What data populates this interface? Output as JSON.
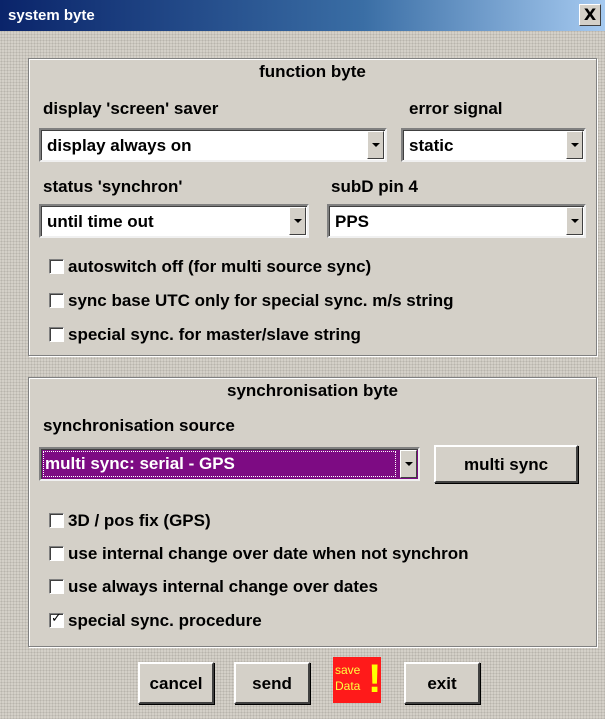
{
  "window": {
    "title": "system byte",
    "close_glyph": "X"
  },
  "function_byte": {
    "title": "function byte",
    "screen_saver": {
      "label": "display 'screen' saver",
      "value": "display always on"
    },
    "error_signal": {
      "label": "error signal",
      "value": "static"
    },
    "status_synchron": {
      "label": "status 'synchron'",
      "value": "until time out"
    },
    "subd_pin4": {
      "label": "subD pin 4",
      "value": "PPS"
    },
    "checkboxes": [
      {
        "label": "autoswitch off (for multi source sync)",
        "checked": false
      },
      {
        "label": "sync base UTC only for special sync. m/s string",
        "checked": false
      },
      {
        "label": "special sync. for master/slave string",
        "checked": false
      }
    ]
  },
  "sync_byte": {
    "title": "synchronisation byte",
    "source": {
      "label": "synchronisation source",
      "value": "multi sync:  serial - GPS"
    },
    "multi_sync_button": "multi sync",
    "checkboxes": [
      {
        "label": "3D / pos fix (GPS)",
        "checked": false
      },
      {
        "label": "use internal change over date when not synchron",
        "checked": false
      },
      {
        "label": "use always internal change over dates",
        "checked": false
      },
      {
        "label": "special sync. procedure",
        "checked": true
      }
    ]
  },
  "buttons": {
    "cancel": "cancel",
    "send": "send",
    "save": {
      "line1": "save",
      "line2": "Data",
      "bang": "!"
    },
    "exit": "exit"
  },
  "icons": {
    "check_mark": "✓"
  },
  "colors": {
    "selected_combo": "#7d0b83",
    "save_bg": "#ff1a1a",
    "save_text": "#ffff00"
  }
}
